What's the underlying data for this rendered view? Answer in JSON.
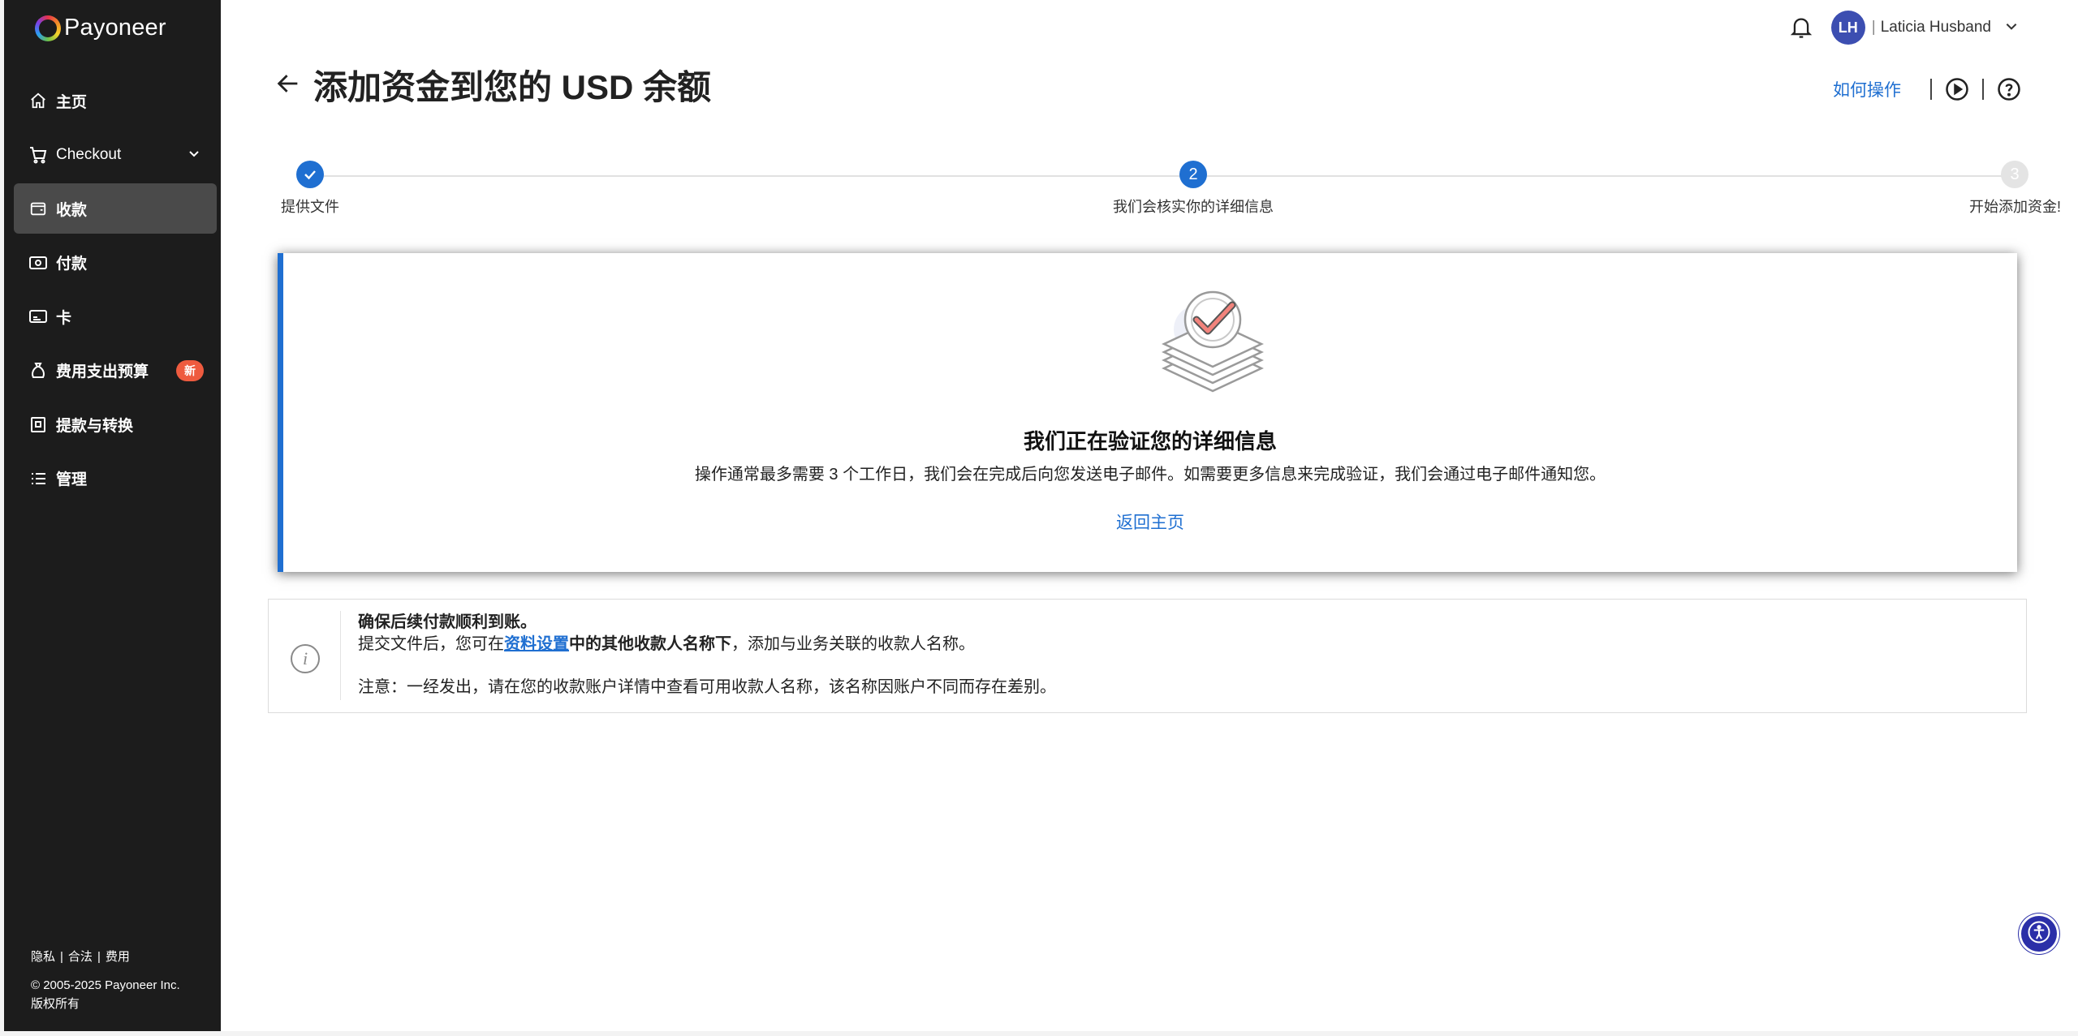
{
  "brand": {
    "name": "Payoneer"
  },
  "sidebar": {
    "items": [
      {
        "label": "主页",
        "icon": "home-icon"
      },
      {
        "label": "Checkout",
        "icon": "cart-icon"
      },
      {
        "label": "收款",
        "icon": "wallet-icon",
        "active": true
      },
      {
        "label": "付款",
        "icon": "payment-icon"
      },
      {
        "label": "卡",
        "icon": "card-icon"
      },
      {
        "label": "费用支出预算",
        "icon": "budget-icon",
        "badge": "新"
      },
      {
        "label": "提款与转换",
        "icon": "withdraw-icon"
      },
      {
        "label": "管理",
        "icon": "list-icon"
      }
    ],
    "footer": {
      "privacy": "隐私",
      "compliance": "合法",
      "fees": "费用",
      "sep": "|",
      "copyright": "© 2005-2025 Payoneer Inc.",
      "rights": "版权所有"
    }
  },
  "header": {
    "avatar_initials": "LH",
    "user_sep": "|",
    "user_name": "Laticia Husband"
  },
  "page": {
    "title": "添加资金到您的 USD 余额",
    "help_link": "如何操作"
  },
  "stepper": {
    "steps": [
      {
        "label": "提供文件",
        "state": "done",
        "number": ""
      },
      {
        "label": "我们会核实你的详细信息",
        "state": "current",
        "number": "2"
      },
      {
        "label": "开始添加资金!",
        "state": "future",
        "number": "3"
      }
    ]
  },
  "verify_card": {
    "title": "我们正在验证您的详细信息",
    "text": "操作通常最多需要 3 个工作日，我们会在完成后向您发送电子邮件。如需要更多信息来完成验证，我们会通过电子邮件通知您。",
    "back_link": "返回主页"
  },
  "info_box": {
    "heading": "确保后续付款顺利到账。",
    "line_prefix": "提交文件后，您可在",
    "link": "资料设置",
    "line_bold": "中的其他收款人名称下",
    "line_suffix": "，添加与业务关联的收款人名称。",
    "note": "注意：一经发出，请在您的收款账户详情中查看可用收款人名称，该名称因账户不同而存在差别。"
  },
  "colors": {
    "accent": "#1f6fd1",
    "sidebar_bg": "#1c1c1c",
    "badge": "#ee5b3f",
    "avatar": "#3c4eb1"
  }
}
